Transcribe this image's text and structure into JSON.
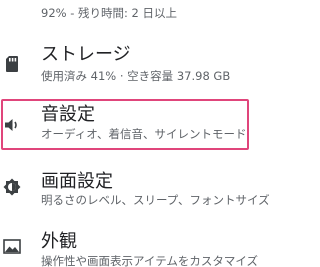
{
  "battery": {
    "summary": "92% - 残り時間: 2 日以上"
  },
  "storage": {
    "icon": "sd-card-icon",
    "title": "ストレージ",
    "summary": "使用済み 41% · 空き容量 37.98 GB"
  },
  "sound": {
    "icon": "volume-icon",
    "title": "音設定",
    "summary": "オーディオ、着信音、サイレントモード",
    "highlight_color": "#e0457b"
  },
  "display": {
    "icon": "brightness-icon",
    "title": "画面設定",
    "summary": "明るさのレベル、スリープ、フォントサイズ"
  },
  "appearance": {
    "icon": "wallpaper-icon",
    "title": "外観",
    "summary": "操作性や画面表示アイテムをカスタマイズ"
  },
  "colors": {
    "icon": "#3c4043",
    "title": "#202124",
    "subtitle": "#5f6368"
  }
}
